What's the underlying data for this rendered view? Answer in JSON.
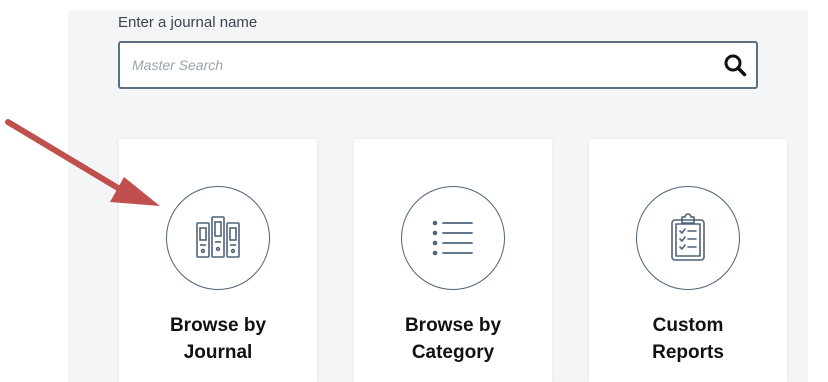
{
  "search": {
    "label": "Enter a journal name",
    "placeholder": "Master Search",
    "value": ""
  },
  "cards": [
    {
      "label": "Browse by\nJournal",
      "icon": "journals-icon"
    },
    {
      "label": "Browse by\nCategory",
      "icon": "list-icon"
    },
    {
      "label": "Custom\nReports",
      "icon": "clipboard-icon"
    }
  ],
  "colors": {
    "icon_stroke": "#4f6379",
    "search_border": "#5a6e86",
    "annotation_arrow": "#c0504d",
    "panel_bg": "#f4f5f7"
  }
}
